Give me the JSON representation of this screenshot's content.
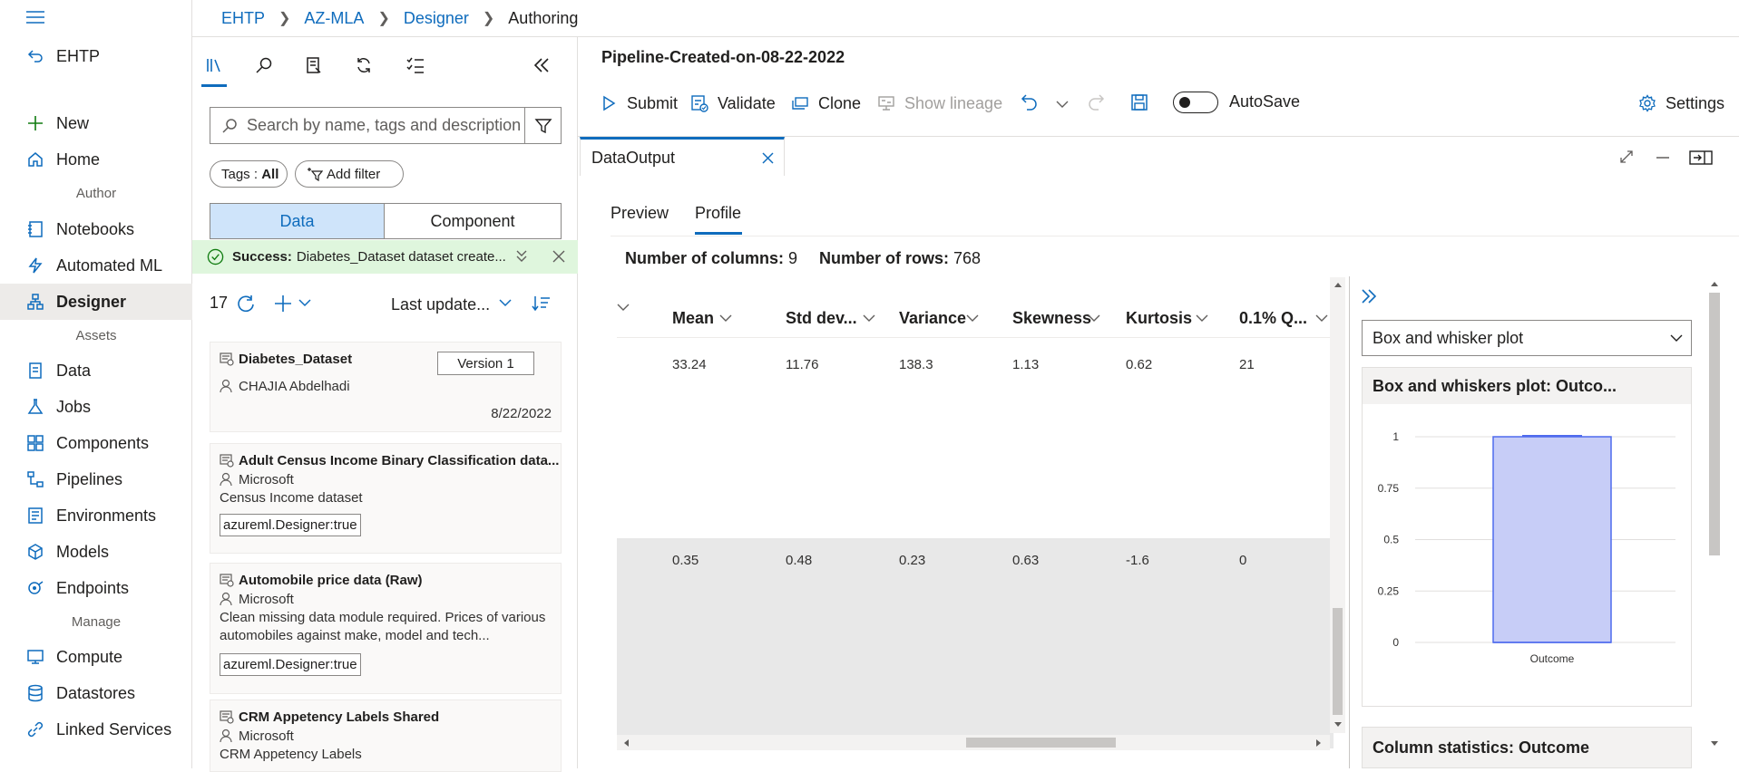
{
  "leftnav": {
    "top_item": "EHTP",
    "items": [
      {
        "label": "New",
        "icon": "plus-icon"
      },
      {
        "label": "Home",
        "icon": "home-icon"
      }
    ],
    "section_author": "Author",
    "author_items": [
      {
        "label": "Notebooks",
        "icon": "notebook-icon"
      },
      {
        "label": "Automated ML",
        "icon": "automl-icon"
      },
      {
        "label": "Designer",
        "icon": "designer-icon"
      }
    ],
    "section_assets": "Assets",
    "asset_items": [
      {
        "label": "Data",
        "icon": "data-icon"
      },
      {
        "label": "Jobs",
        "icon": "jobs-icon"
      },
      {
        "label": "Components",
        "icon": "components-icon"
      },
      {
        "label": "Pipelines",
        "icon": "pipelines-icon"
      },
      {
        "label": "Environments",
        "icon": "environments-icon"
      },
      {
        "label": "Models",
        "icon": "models-icon"
      },
      {
        "label": "Endpoints",
        "icon": "endpoints-icon"
      }
    ],
    "section_manage": "Manage",
    "manage_items": [
      {
        "label": "Compute",
        "icon": "compute-icon"
      },
      {
        "label": "Datastores",
        "icon": "datastores-icon"
      },
      {
        "label": "Linked Services",
        "icon": "linked-services-icon"
      }
    ]
  },
  "breadcrumb": [
    "EHTP",
    "AZ-MLA",
    "Designer",
    "Authoring"
  ],
  "asset_panel": {
    "search_placeholder": "Search by name, tags and description",
    "tags_label": "Tags : ",
    "tags_value": "All",
    "add_filter": "Add filter",
    "seg_data": "Data",
    "seg_component": "Component",
    "success_bold": "Success:",
    "success_text": "Diabetes_Dataset dataset create...",
    "count": "17",
    "sort_label": "Last update...",
    "cards": [
      {
        "title": "Diabetes_Dataset",
        "version": "Version 1",
        "owner": "CHAJIA Abdelhadi",
        "date": "8/22/2022"
      },
      {
        "title": "Adult Census Income Binary Classification data...",
        "owner": "Microsoft",
        "desc": "Census Income dataset",
        "tag": "azureml.Designer:true"
      },
      {
        "title": "Automobile price data (Raw)",
        "owner": "Microsoft",
        "desc": "Clean missing data module required. Prices of various automobiles against make, model and tech...",
        "tag": "azureml.Designer:true"
      },
      {
        "title": "CRM Appetency Labels Shared",
        "owner": "Microsoft",
        "desc": "CRM Appetency Labels"
      }
    ]
  },
  "pipeline": {
    "title": "Pipeline-Created-on-08-22-2022",
    "submit": "Submit",
    "validate": "Validate",
    "clone": "Clone",
    "show_lineage": "Show lineage",
    "autosave": "AutoSave",
    "settings": "Settings"
  },
  "data_output": {
    "tab_title": "DataOutput",
    "subtabs": [
      "Preview",
      "Profile"
    ],
    "num_columns_label": "Number of columns:",
    "num_columns": "9",
    "num_rows_label": "Number of rows:",
    "num_rows": "768",
    "columns": [
      "Mean",
      "Std dev...",
      "Variance",
      "Skewness",
      "Kurtosis",
      "0.1% Q..."
    ],
    "rows": [
      [
        "33.24",
        "11.76",
        "138.3",
        "1.13",
        "0.62",
        "21"
      ],
      [
        "0.35",
        "0.48",
        "0.23",
        "0.63",
        "-1.6",
        "0"
      ]
    ]
  },
  "box_panel": {
    "dropdown_value": "Box and whisker plot",
    "plot_title": "Box and whiskers plot: Outco...",
    "column_stats_title": "Column statistics: Outcome"
  },
  "chart_data": {
    "type": "box",
    "title": "Box and whiskers plot: Outco...",
    "categories": [
      "Outcome"
    ],
    "yticks": [
      "1",
      "0.75",
      "0.5",
      "0.25",
      "0"
    ],
    "ylim": [
      0,
      1
    ],
    "series": [
      {
        "min": 0,
        "q1": 0,
        "median": 0,
        "q3": 1,
        "max": 1
      }
    ]
  },
  "colors": {
    "accent": "#0f6cbd",
    "success_bg": "#dff6dd",
    "box_fill": "#c7cdf7",
    "box_stroke": "#4f6bed"
  }
}
